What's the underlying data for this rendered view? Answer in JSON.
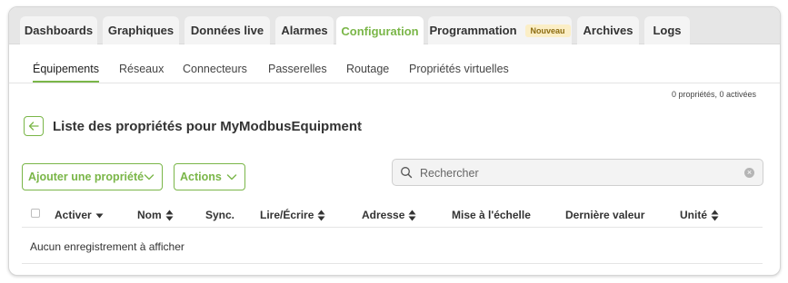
{
  "tabs": [
    {
      "label": "Dashboards"
    },
    {
      "label": "Graphiques"
    },
    {
      "label": "Données live"
    },
    {
      "label": "Alarmes"
    },
    {
      "label": "Configuration",
      "active": true
    },
    {
      "label": "Programmation",
      "badge": "Nouveau"
    },
    {
      "label": "Archives"
    },
    {
      "label": "Logs"
    }
  ],
  "subtabs": [
    {
      "label": "Équipements",
      "active": true
    },
    {
      "label": "Réseaux"
    },
    {
      "label": "Connecteurs"
    },
    {
      "label": "Passerelles"
    },
    {
      "label": "Routage"
    },
    {
      "label": "Propriétés virtuelles"
    }
  ],
  "count_label": "0 propriétés, 0 activées",
  "page": {
    "title": "Liste des propriétés pour MyModbusEquipment",
    "title_suffix": "-"
  },
  "toolbar": {
    "add_label": "Ajouter une propriété",
    "actions_label": "Actions"
  },
  "search": {
    "placeholder": "Rechercher",
    "value": ""
  },
  "table": {
    "columns": [
      {
        "label": "Activer",
        "sort": "down"
      },
      {
        "label": "Nom",
        "sort": "both"
      },
      {
        "label": "Sync.",
        "sort": "none"
      },
      {
        "label": "Lire/Écrire",
        "sort": "both"
      },
      {
        "label": "Adresse",
        "sort": "both"
      },
      {
        "label": "Mise à l'échelle",
        "sort": "none"
      },
      {
        "label": "Dernière valeur",
        "sort": "none"
      },
      {
        "label": "Unité",
        "sort": "both"
      }
    ],
    "empty_message": "Aucun enregistrement à afficher"
  },
  "colors": {
    "accent": "#7ab648",
    "badge_bg": "#fbeec6",
    "badge_text": "#8c6c10"
  },
  "icons": {
    "back": "arrow-left-icon",
    "dropdown": "chevron-down-icon",
    "search": "search-icon",
    "clear": "clear-icon",
    "sort": "sort-icon"
  }
}
